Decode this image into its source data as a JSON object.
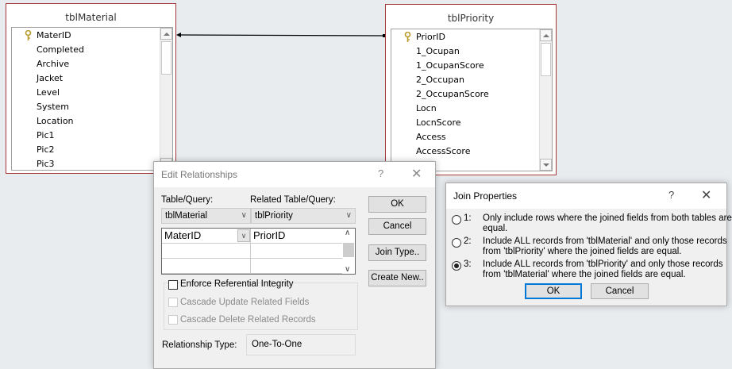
{
  "tables": [
    {
      "name": "tblMaterial",
      "fields": [
        "MaterID",
        "Completed",
        "Archive",
        "Jacket",
        "Level",
        "System",
        "Location",
        "Pic1",
        "Pic2",
        "Pic3"
      ],
      "primary_key": "MaterID"
    },
    {
      "name": "tblPriority",
      "fields": [
        "PriorID",
        "1_Ocupan",
        "1_OcupanScore",
        "2_Occupan",
        "2_OccupanScore",
        "Locn",
        "LocnScore",
        "Access",
        "AccessScore"
      ],
      "primary_key": "PriorID"
    }
  ],
  "edit_relationships": {
    "title": "Edit Relationships",
    "help": "?",
    "close": "✕",
    "table_label": "Table/Query:",
    "related_label": "Related Table/Query:",
    "table_value": "tblMaterial",
    "related_value": "tblPriority",
    "grid": [
      [
        "MaterID",
        "PriorID"
      ],
      [
        "",
        ""
      ],
      [
        "",
        ""
      ]
    ],
    "enforce_ri": "Enforce Referential Integrity",
    "enforce_ri_checked": false,
    "cascade_update": "Cascade Update Related Fields",
    "cascade_delete": "Cascade Delete Related Records",
    "relationship_type_label": "Relationship Type:",
    "relationship_type_value": "One-To-One",
    "ok": "OK",
    "cancel": "Cancel",
    "join_type": "Join Type..",
    "create_new": "Create New.."
  },
  "join_properties": {
    "title": "Join Properties",
    "help": "?",
    "close": "✕",
    "selected": 3,
    "options": [
      {
        "num": "1:",
        "line1": "Only include rows where the joined fields from both tables are",
        "line2": "equal."
      },
      {
        "num": "2:",
        "line1": "Include ALL records from 'tblMaterial' and only those records",
        "line2": "from 'tblPriority' where the joined fields are equal."
      },
      {
        "num": "3:",
        "line1": "Include ALL records from 'tblPriority' and only those records",
        "line2": "from 'tblMaterial' where the joined fields are equal."
      }
    ],
    "ok": "OK",
    "cancel": "Cancel"
  },
  "colors": {
    "table_border": "#a4373a",
    "canvas": "#e9ecef",
    "dialog": "#f0f0f0",
    "focus": "#0078d7"
  }
}
